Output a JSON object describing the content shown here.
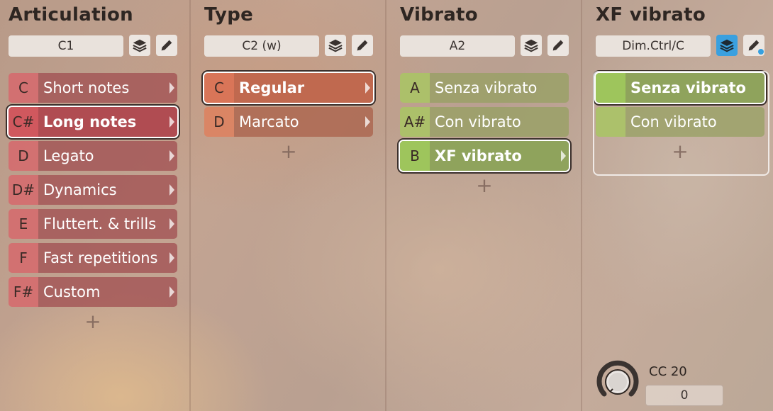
{
  "columns": [
    {
      "title": "Articulation",
      "key_value": "C1",
      "items": [
        {
          "key": "C",
          "label": "Short notes"
        },
        {
          "key": "C#",
          "label": "Long notes"
        },
        {
          "key": "D",
          "label": "Legato"
        },
        {
          "key": "D#",
          "label": "Dynamics"
        },
        {
          "key": "E",
          "label": "Fluttert. & trills"
        },
        {
          "key": "F",
          "label": "Fast repetitions"
        },
        {
          "key": "F#",
          "label": "Custom"
        }
      ],
      "selected_index": 1,
      "add_label": "+"
    },
    {
      "title": "Type",
      "key_value": "C2 (w)",
      "items": [
        {
          "key": "C",
          "label": "Regular"
        },
        {
          "key": "D",
          "label": "Marcato"
        }
      ],
      "selected_index": 0,
      "add_label": "+"
    },
    {
      "title": "Vibrato",
      "key_value": "A2",
      "items": [
        {
          "key": "A",
          "label": "Senza vibrato"
        },
        {
          "key": "A#",
          "label": "Con vibrato"
        },
        {
          "key": "B",
          "label": "XF vibrato"
        }
      ],
      "selected_index": 2,
      "add_label": "+"
    },
    {
      "title": "XF vibrato",
      "key_value": "Dim.Ctrl/C",
      "items": [
        {
          "key": "",
          "label": "Senza vibrato"
        },
        {
          "key": "",
          "label": "Con vibrato"
        }
      ],
      "selected_index": 0,
      "add_label": "+"
    }
  ],
  "controller": {
    "label": "CC 20",
    "value": "0"
  },
  "colors": {
    "articulation": "#b04c52",
    "type": "#c0694f",
    "vibrato": "#8fa35c",
    "active_button": "#3aa0df"
  },
  "icons": {
    "layers": "layers-icon",
    "edit": "pencil-icon",
    "knob": "knob-icon"
  }
}
